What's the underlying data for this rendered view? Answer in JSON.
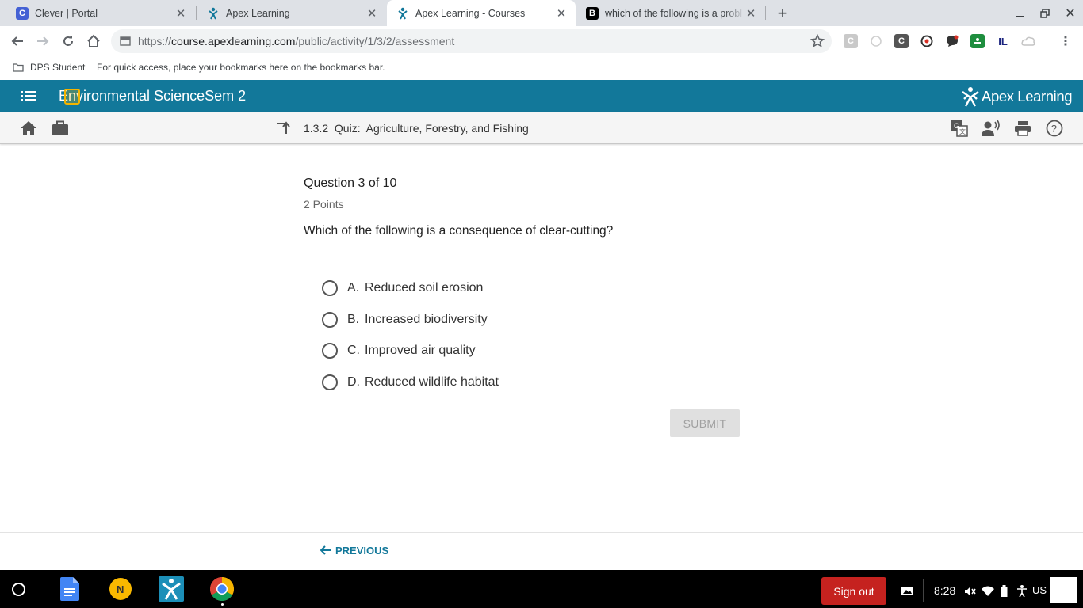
{
  "browser": {
    "tabs": [
      {
        "title": "Clever | Portal",
        "favicon": "C",
        "favicon_color": "#4461d4"
      },
      {
        "title": "Apex Learning",
        "favicon": "apex-icon",
        "favicon_color": "#12789a"
      },
      {
        "title": "Apex Learning - Courses",
        "favicon": "apex-icon",
        "favicon_color": "#12789a"
      },
      {
        "title": "which of the following is a probl",
        "favicon": "B",
        "favicon_color": "#000000"
      }
    ],
    "url": {
      "scheme": "https://",
      "host": "course.apexlearning.com",
      "path": "/public/activity/1/3/2/assessment"
    },
    "bookmarks": {
      "folder": "DPS Student",
      "hint": "For quick access, place your bookmarks here on the bookmarks bar."
    }
  },
  "app": {
    "course_title": "Environmental ScienceSem 2",
    "brand": "Apex Learning",
    "activity_number": "1.3.2",
    "activity_type": "Quiz:",
    "activity_name": "Agriculture, Forestry, and Fishing"
  },
  "question": {
    "counter": "Question 3 of 10",
    "points": "2 Points",
    "prompt": "Which of the following is a consequence of clear-cutting?",
    "options": [
      {
        "letter": "A.",
        "text": "Reduced soil erosion"
      },
      {
        "letter": "B.",
        "text": "Increased biodiversity"
      },
      {
        "letter": "C.",
        "text": "Improved air quality"
      },
      {
        "letter": "D.",
        "text": "Reduced wildlife habitat"
      }
    ],
    "submit_label": "SUBMIT"
  },
  "footer": {
    "previous_label": "PREVIOUS"
  },
  "shelf": {
    "sign_out": "Sign out",
    "time": "8:28",
    "locale": "US"
  },
  "colors": {
    "brand": "#12789a",
    "sign_out": "#c5221f",
    "submit_disabled": "#e0e0e0"
  }
}
